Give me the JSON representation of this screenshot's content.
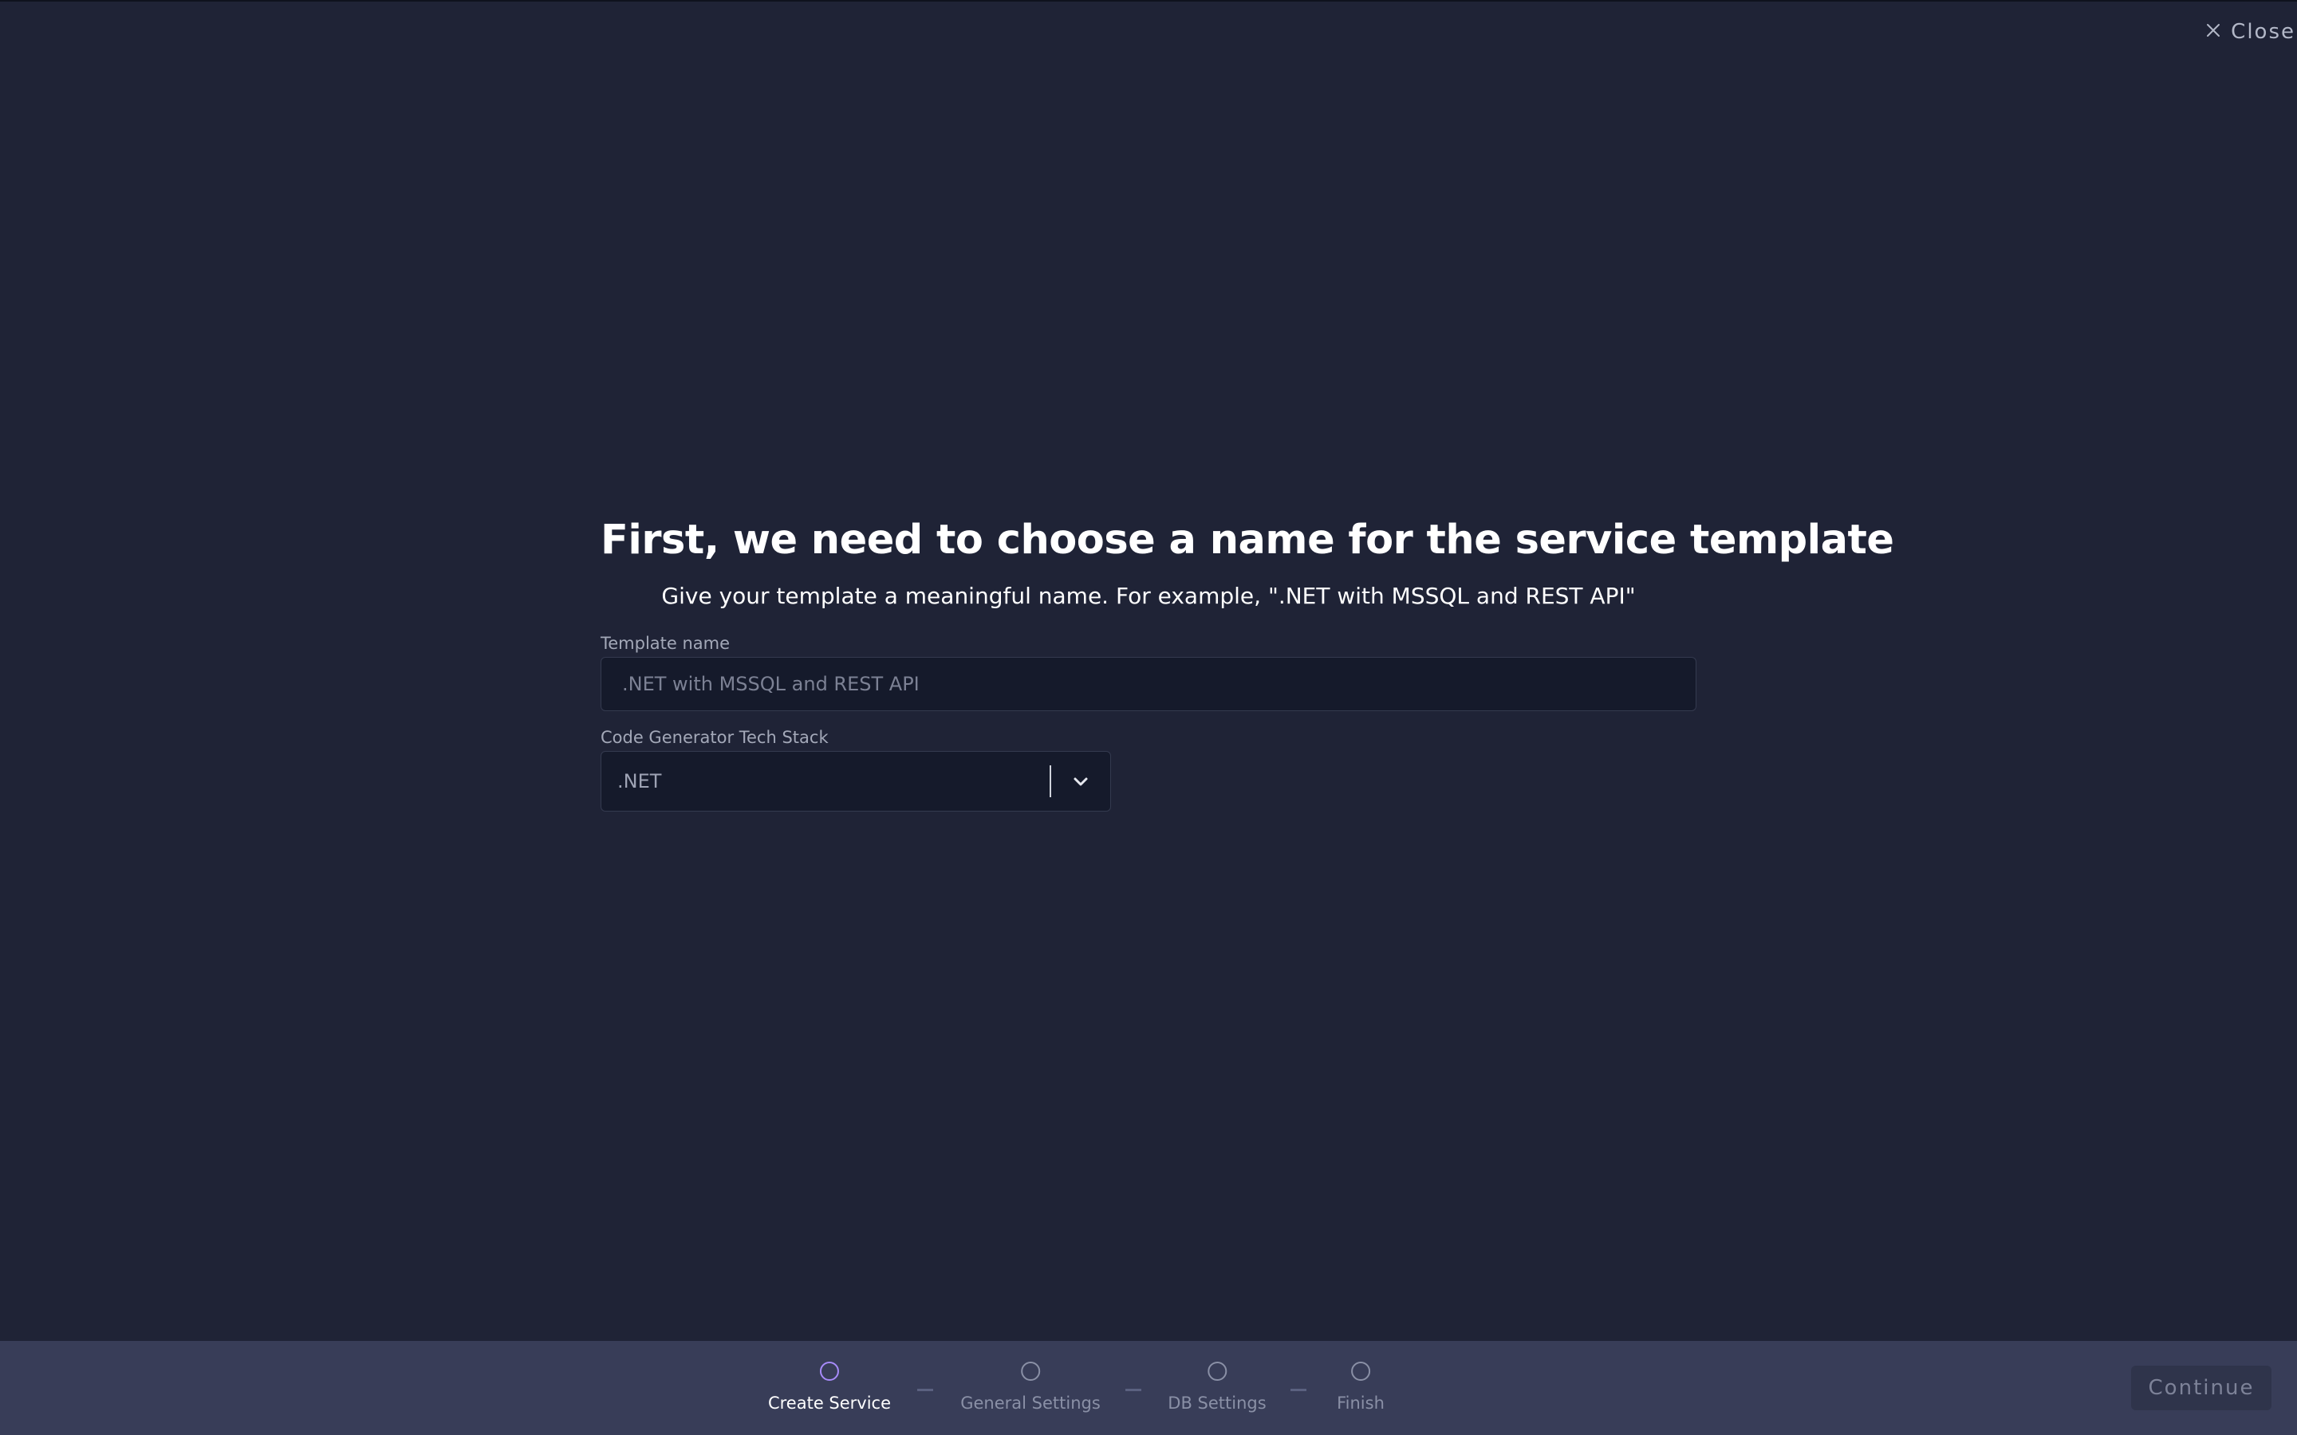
{
  "header": {
    "close_label": "Close"
  },
  "main": {
    "title": "First, we need to choose a name for the service template",
    "subtitle": "Give your template a meaningful name. For example, \".NET with MSSQL and REST API\"",
    "template_name": {
      "label": "Template name",
      "value": "",
      "placeholder": ".NET with MSSQL and REST API"
    },
    "tech_stack": {
      "label": "Code Generator Tech Stack",
      "selected": ".NET"
    }
  },
  "footer": {
    "steps": [
      {
        "label": "Create Service",
        "active": true
      },
      {
        "label": "General Settings",
        "active": false
      },
      {
        "label": "DB Settings",
        "active": false
      },
      {
        "label": "Finish",
        "active": false
      }
    ],
    "continue_label": "Continue"
  },
  "colors": {
    "background": "#1f2336",
    "footer_background": "#383d58",
    "input_background": "#151a2b",
    "active_step": "#a78bfa",
    "continue_disabled": "#2f344b"
  },
  "icons": {
    "close": "x-icon",
    "dropdown": "chevron-down-icon",
    "step": "circle-icon"
  }
}
